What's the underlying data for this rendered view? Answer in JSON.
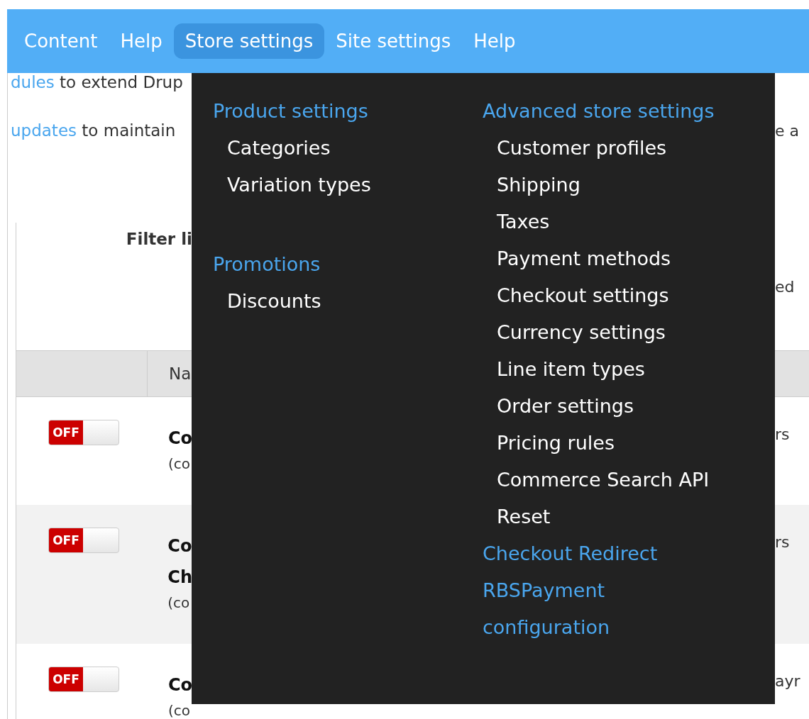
{
  "nav": [
    {
      "label": "Content",
      "selected": false
    },
    {
      "label": "Help",
      "selected": false
    },
    {
      "label": "Store settings",
      "selected": true
    },
    {
      "label": "Site settings",
      "selected": false
    },
    {
      "label": "Help",
      "selected": false
    }
  ],
  "intro": [
    {
      "link": "dules",
      "text": "to extend Drup"
    },
    {
      "link": "updates",
      "text": "to maintain",
      "right": "e a"
    }
  ],
  "filter": {
    "label": "Filter li",
    "right": "ed"
  },
  "table": {
    "header": "Na",
    "rows": [
      {
        "on": false,
        "toggle": "OFF",
        "name": [
          "Co"
        ],
        "machine": "(co",
        "right": "rs"
      },
      {
        "on": false,
        "toggle": "OFF",
        "name": [
          "Co",
          "Ch"
        ],
        "machine": "(co",
        "right": "rs"
      },
      {
        "on": false,
        "toggle": "OFF",
        "name": [
          "Co"
        ],
        "machine": "(co",
        "right": "ayr"
      }
    ]
  },
  "menu": {
    "columns": [
      {
        "groups": [
          {
            "heading": "Product settings",
            "items": [
              "Categories",
              "Variation types"
            ]
          },
          {
            "heading": "Promotions",
            "items": [
              "Discounts"
            ]
          }
        ]
      },
      {
        "groups": [
          {
            "heading": "Advanced store settings",
            "items": [
              "Customer profiles",
              "Shipping",
              "Taxes",
              "Payment methods",
              "Checkout settings",
              "Currency settings",
              "Line item types",
              "Order settings",
              "Pricing rules",
              "Commerce Search API",
              "Reset"
            ]
          },
          {
            "heading": "Checkout Redirect"
          },
          {
            "heading": "RBSPayment configuration"
          }
        ]
      }
    ]
  }
}
